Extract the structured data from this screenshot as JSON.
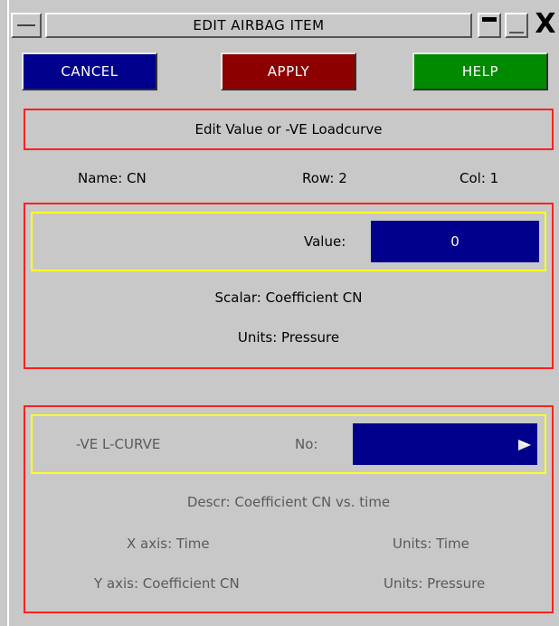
{
  "window": {
    "title": "EDIT AIRBAG ITEM",
    "close_glyph": "X"
  },
  "buttons": {
    "cancel": "CANCEL",
    "apply": "APPLY",
    "help": "HELP"
  },
  "header": {
    "mode_label": "Edit Value or -VE Loadcurve",
    "name": "Name: CN",
    "row": "Row: 2",
    "col": "Col: 1"
  },
  "value_section": {
    "value_label": "Value:",
    "value": "0",
    "scalar": "Scalar: Coefficient CN",
    "units": "Units: Pressure"
  },
  "curve_section": {
    "label": "-VE L-CURVE",
    "no_label": "No:",
    "no_value": "",
    "descr": "Descr: Coefficient CN vs. time",
    "x_axis": "X axis: Time",
    "x_units": "Units: Time",
    "y_axis": "Y axis: Coefficient CN",
    "y_units": "Units: Pressure"
  },
  "colors": {
    "cancel": "#00008c",
    "apply": "#8c0000",
    "help": "#008a00",
    "frame": "#ff2020",
    "highlight": "#ffff20"
  }
}
